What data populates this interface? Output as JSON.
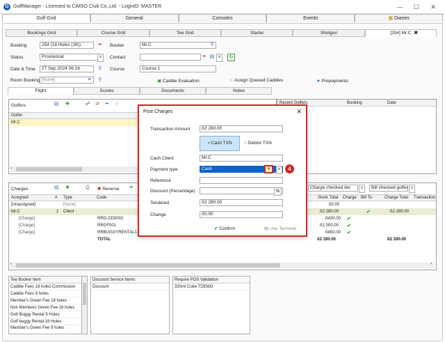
{
  "window": {
    "title": "GolfManager - Licensed to CiMSO Club Co.,Ltd. - LoginID: MASTER",
    "minimize": "—",
    "maximize": "☐",
    "close": "✕"
  },
  "top_tabs": [
    "Golf Grid",
    "General",
    "Consoles",
    "Events",
    "Diaries"
  ],
  "sub_tabs": [
    "Bookings Grid",
    "Course Grid",
    "Tee Grid",
    "Starter",
    "Shotgun",
    "[254] Mr.C"
  ],
  "booking_form": {
    "booking_label": "Booking",
    "booking_value": "254 (18 Holes (18))",
    "booker_label": "Booker",
    "booker_value": "Mr.C",
    "status_label": "Status",
    "status_value": "Provisional",
    "contact_label": "Contact",
    "datetime_label": "Date & Time",
    "datetime_value": "27 Sep 2024 06:16",
    "course_label": "Course",
    "course_value": "Course 1",
    "room_label": "Room Booking",
    "room_value": "[None]",
    "caddie_eval": "Caddie Evaluation",
    "assign_caddies": "Assign Queued Caddies",
    "prepayments": "Prepayments"
  },
  "section_tabs": [
    "Flight",
    "Scores",
    "Documents",
    "Notes"
  ],
  "golfers": {
    "title": "Golfers",
    "col_golfer": "Golfer",
    "row1": "Mr.C",
    "recent_col1": "Recent Golfers",
    "recent_col2": "Booking",
    "recent_col3": "Date"
  },
  "charges": {
    "title": "Charges",
    "reverse": "Reverse",
    "headers": [
      "Assigned",
      "#",
      "Type",
      "Code"
    ],
    "right_headers": [
      "Stock Total",
      "Charge",
      "Bill To",
      "Charge Total",
      "Transaction"
    ],
    "filter1": "Charge checked iter",
    "filter2": "Bill checked golfers",
    "rows": [
      {
        "assigned": "[Unassigned]",
        "num": "",
        "type": "[None]",
        "code": "",
        "stock": "ß0.00",
        "charge": "",
        "billto": "",
        "total": ""
      },
      {
        "assigned": "Mr.C",
        "num": "1",
        "type": "Client",
        "code": "",
        "stock": "ß2 280.00",
        "charge": "",
        "billto": "✔",
        "total": "ß2 280.00"
      },
      {
        "assigned": "[Charge]",
        "num": "",
        "type": "",
        "code": "RRG-CD0002",
        "stock": "ß430.00",
        "charge": "✔",
        "billto": "",
        "total": ""
      },
      {
        "assigned": "[Charge]",
        "num": "",
        "type": "",
        "code": "RRGF001",
        "stock": "ß1 000.00",
        "charge": "✔",
        "billto": "",
        "total": ""
      },
      {
        "assigned": "[Charge]",
        "num": "",
        "type": "",
        "code": "RRBUGGYRENTAL1",
        "stock": "ß850.00",
        "charge": "✔",
        "billto": "",
        "total": ""
      },
      {
        "assigned": "",
        "num": "",
        "type": "",
        "code": "TOTAL",
        "stock": "ß2 280.00",
        "charge": "",
        "billto": "",
        "total": "ß2 280.00"
      }
    ]
  },
  "bottom_lists": {
    "tee_booker": {
      "title": "Tee Booker Item",
      "items": [
        "Caddie Fees 18 holes Commission",
        "Caddie Fees 9 holes",
        "Member's Green Fee 18 holes",
        "Non Members Green Fee 18 holes",
        "Golf Buggy Rental 9 Holes",
        "Golf buggy Rental 18 Holes",
        "Member's Green Fee 9 holes"
      ]
    },
    "discount": {
      "title": "Discount Service Items",
      "items": [
        "Discount"
      ]
    },
    "pos": {
      "title": "Require POS Validation",
      "items": [
        "330ml Coke TDEMO"
      ]
    }
  },
  "modal": {
    "title": "Post Charges",
    "close": "✕",
    "amount_label": "Transaction Amount",
    "amount_value": "ß2 280.00",
    "cash_txn": "Cash TXN",
    "debtor_txn": "Debtor TXN",
    "cash_client_label": "Cash Client",
    "cash_client_value": "Mr.C",
    "payment_type_label": "Payment type",
    "payment_type_value": "Cash",
    "reference_label": "Reference",
    "discount_label": "Discount (Percentage)",
    "discount_value": "%",
    "tendered_label": "Tendered",
    "tendered_value": "ß2 280.00",
    "change_label": "Change",
    "change_value": "ß0.00",
    "confirm": "Confirm",
    "use_terminal": "Use Terminal",
    "callout": "4"
  },
  "colors": {
    "accent": "#d32525",
    "selection": "#0a64c8",
    "check": "#2e9e2e"
  }
}
